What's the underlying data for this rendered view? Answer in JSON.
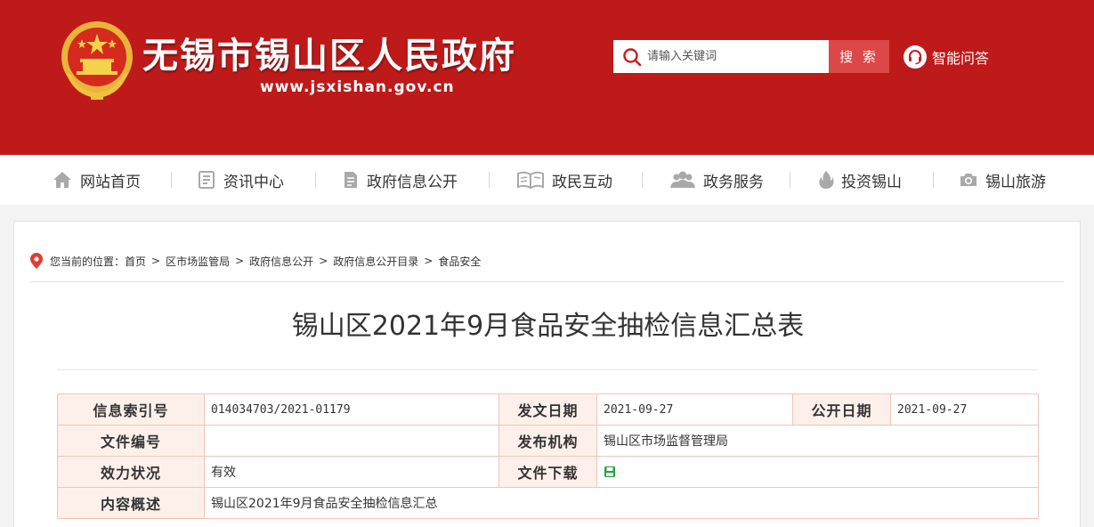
{
  "header": {
    "site_title": "无锡市锡山区人民政府",
    "site_url": "www.jsxishan.gov.cn",
    "search": {
      "placeholder": "请输入关键词",
      "button_label": "搜 索"
    },
    "qa_label": "智能问答",
    "colors": {
      "header_bg": "#be1a1a",
      "search_button": "#dc4747"
    }
  },
  "nav": {
    "items": [
      {
        "label": "网站首页",
        "icon": "home-icon"
      },
      {
        "label": "资讯中心",
        "icon": "news-icon"
      },
      {
        "label": "政府信息公开",
        "icon": "document-icon"
      },
      {
        "label": "政民互动",
        "icon": "book-icon"
      },
      {
        "label": "政务服务",
        "icon": "people-icon"
      },
      {
        "label": "投资锡山",
        "icon": "fire-icon"
      },
      {
        "label": "锡山旅游",
        "icon": "camera-icon"
      }
    ]
  },
  "breadcrumb": {
    "prefix": "您当前的位置：",
    "items": [
      "首页",
      "区市场监管局",
      "政府信息公开",
      "政府信息公开目录",
      "食品安全"
    ]
  },
  "article": {
    "title": "锡山区2021年9月食品安全抽检信息汇总表"
  },
  "meta": {
    "index_label": "信息索引号",
    "index_value": "014034703/2021-01179",
    "issue_date_label": "发文日期",
    "issue_date_value": "2021-09-27",
    "public_date_label": "公开日期",
    "public_date_value": "2021-09-27",
    "doc_no_label": "文件编号",
    "doc_no_value": "",
    "publisher_label": "发布机构",
    "publisher_value": "锡山区市场监督管理局",
    "validity_label": "效力状况",
    "validity_value": "有效",
    "download_label": "文件下载",
    "summary_label": "内容概述",
    "summary_value": "锡山区2021年9月食品安全抽检信息汇总"
  }
}
